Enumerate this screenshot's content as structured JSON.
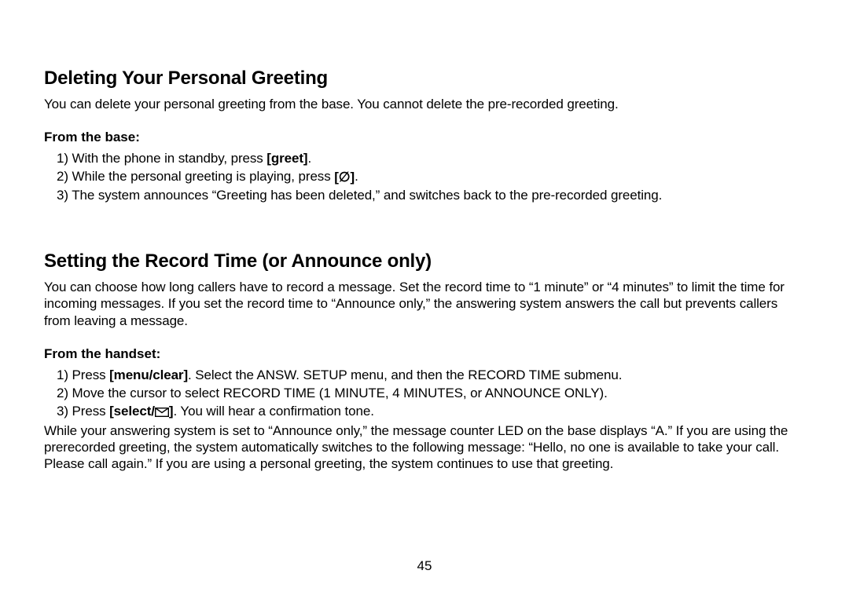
{
  "section1": {
    "heading": "Deleting Your Personal Greeting",
    "intro": "You can delete your personal greeting from the base. You cannot delete the pre-recorded greeting.",
    "subheading": "From the base:",
    "step1_pre": "1) With the phone in standby, press ",
    "step1_bold": "[greet]",
    "step1_post": ".",
    "step2_pre": "2) While the personal greeting is playing, press ",
    "step2_icon": "[∅]",
    "step2_post": ".",
    "step3": "3) The system announces “Greeting has been deleted,” and switches back to the pre-recorded greeting."
  },
  "section2": {
    "heading": "Setting the Record Time (or Announce only)",
    "intro": "You can choose how long callers have to record a message. Set the record time to “1 minute” or “4 minutes” to limit the time for incoming messages. If you set the record time to “Announce only,” the answering system answers the call but prevents callers from leaving a message.",
    "subheading": "From the handset:",
    "step1_pre": "1) Press ",
    "step1_bold": "[menu/clear]",
    "step1_post": ".  Select the ANSW. SETUP menu, and then the RECORD TIME submenu.",
    "step2": "2) Move the cursor to select RECORD TIME (1 MINUTE, 4 MINUTES, or ANNOUNCE ONLY).",
    "step3_pre": "3) Press ",
    "step3_bold_pre": "[select/",
    "step3_bold_post": "]",
    "step3_post": ". You will hear a confirmation tone.",
    "footnote": "While your answering system is set to “Announce only,” the message counter LED on the base displays “A.” If you are using the prerecorded greeting, the system automatically switches to the following message: “Hello, no one is available to take your call. Please call again.” If you are using a personal greeting, the system continues to use that greeting."
  },
  "page_number": "45"
}
